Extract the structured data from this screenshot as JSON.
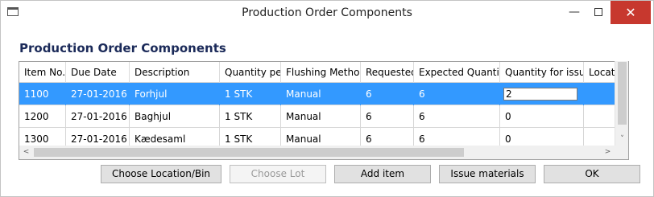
{
  "window": {
    "title": "Production Order Components",
    "minimize_glyph": "—",
    "close_glyph": "✕"
  },
  "panel": {
    "title": "Production Order Components"
  },
  "grid": {
    "columns": [
      "Item No.",
      "Due Date",
      "Description",
      "Quantity per",
      "Flushing Method",
      "Requested",
      "Expected Quantity",
      "Quantity for issue",
      "Location"
    ],
    "rows": [
      {
        "item_no": "1100",
        "due_date": "27-01-2016",
        "description": "Forhjul",
        "quantity_per": "1 STK",
        "flushing_method": "Manual",
        "requested": "6",
        "expected_quantity": "6",
        "quantity_for_issue": "2",
        "location": "",
        "selected": true
      },
      {
        "item_no": "1200",
        "due_date": "27-01-2016",
        "description": "Baghjul",
        "quantity_per": "1 STK",
        "flushing_method": "Manual",
        "requested": "6",
        "expected_quantity": "6",
        "quantity_for_issue": "0",
        "location": ""
      },
      {
        "item_no": "1300",
        "due_date": "27-01-2016",
        "description": "Kædesaml",
        "quantity_per": "1 STK",
        "flushing_method": "Manual",
        "requested": "6",
        "expected_quantity": "6",
        "quantity_for_issue": "0",
        "location": ""
      }
    ]
  },
  "scrollbars": {
    "up": "▲",
    "down": "˅",
    "left": "<",
    "right": ">"
  },
  "buttons": {
    "choose_location_bin": "Choose Location/Bin",
    "choose_lot": "Choose Lot",
    "add_item": "Add item",
    "issue_materials": "Issue materials",
    "ok": "OK"
  },
  "colors": {
    "selection": "#3399ff",
    "title_text": "#1b2a59",
    "close_button": "#c7382e"
  }
}
